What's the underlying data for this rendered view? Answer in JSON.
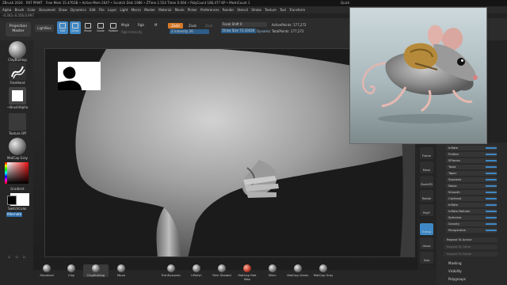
{
  "titlebar": {
    "app": "ZBrush 2024",
    "file": "RAT PRINT",
    "stats": "Free Mem 15.476GB • Active Mem 2647 • Scratch Disk 1986 • ZTime 2.554 Timer 0.064 • PolyCount 186,477 KP • MeshCount 1",
    "quick": "Quick"
  },
  "menubar": [
    "Alpha",
    "Brush",
    "Color",
    "Document",
    "Draw",
    "Dynamics",
    "Edit",
    "File",
    "Layer",
    "Light",
    "Macro",
    "Marker",
    "Material",
    "Movie",
    "Picker",
    "Preferences",
    "Render",
    "Stencil",
    "Stroke",
    "Texture",
    "Tool",
    "Transform"
  ],
  "coords": "-0.303,-0.356,0.997",
  "toolbar": {
    "projection": "Projection Master",
    "lightbox": "LightBox",
    "buttons": [
      "Edit",
      "Draw",
      "Move",
      "Scale",
      "Rotate"
    ],
    "mrgb": "Mrgb",
    "rgb": "Rgb",
    "m": "M",
    "rgb_intensity": "Rgb Intensity",
    "zadd": "Zadd",
    "zsub": "Zsub",
    "zcut": "Zcut",
    "z_intensity": "Z Intensity 26",
    "focal_shift": "Focal Shift 0",
    "draw_size": "Draw Size 73.10426",
    "dynamic": "Dynamic",
    "active_points": "ActivePoints: 177,272",
    "total_points": "TotalPoints: 177,272"
  },
  "leftshelf": {
    "brush": "ClayBuildup",
    "stroke": "FreeHand",
    "alpha": "~BrushAlpha",
    "texture": "Texture Off",
    "material": "MatCap Gray",
    "gradient": "Gradient",
    "switch_color": "SwitchColor",
    "alternate": "Alternate"
  },
  "rightshelf": [
    "Frame",
    "Move",
    "Zoom3D",
    "Rotate",
    "PolyF",
    "Transp",
    "Ghost",
    "Solo",
    "Xpose"
  ],
  "palette": {
    "sliders": [
      "Inflate",
      "Flatten",
      "SPlanes",
      "Twist",
      "Taper",
      "Squeeze",
      "Noise",
      "Smooth",
      "Contrast",
      "Inflate",
      "Inflate Balloon",
      "Spherize",
      "Gravity",
      "Perspective"
    ],
    "buttons": [
      "Repeat To Active",
      "Repeat To Other",
      "Repeat To Folder"
    ],
    "sections": [
      "Masking",
      "Visibility",
      "Polygroups"
    ]
  },
  "brushes": [
    "Standard",
    "Clay",
    "ClayBuildup",
    "Move",
    "TrimDynamic",
    "hPolish",
    "Skin Shaded",
    "MatCap Red Wax",
    "Blinn",
    "MatCap Green",
    "MatCap Gray"
  ],
  "colors": {
    "accent_blue": "#3f88c5",
    "zadd_orange": "#d67a2a",
    "bg": "#222222"
  }
}
